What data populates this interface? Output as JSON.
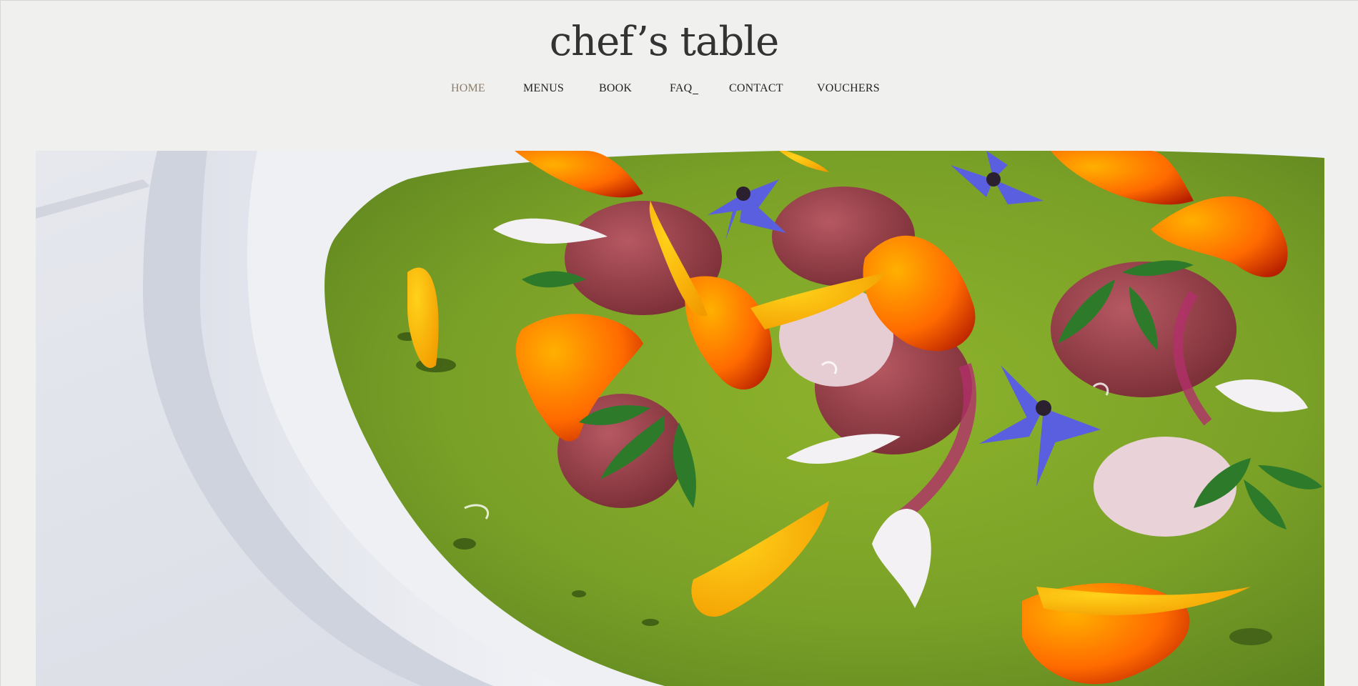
{
  "site": {
    "logo_text": "chef’s table"
  },
  "nav": {
    "items": [
      {
        "label": "HOME",
        "active": true
      },
      {
        "label": "MENUS",
        "active": false
      },
      {
        "label": "BOOK",
        "active": false
      },
      {
        "label": "FAQ",
        "active": false
      },
      {
        "label": "CONTACT",
        "active": false
      },
      {
        "label": "VOUCHERS",
        "active": false
      }
    ]
  },
  "colors": {
    "background": "#f0f0ee",
    "text": "#222222",
    "active_nav": "#8b7d6b",
    "sauce_green": "#7fa52a",
    "plate_white": "#e9ebf0"
  },
  "hero": {
    "image_semantic": "plated-dish-with-edible-flowers"
  }
}
